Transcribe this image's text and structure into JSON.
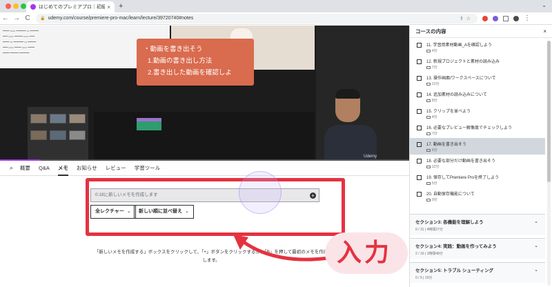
{
  "browser": {
    "tab_title": "はじめてのプレミアプロ｜初級入",
    "tab_close": "×",
    "new_tab": "+",
    "url": "udemy.com/course/premiere-pro-mac/learn/lecture/39720740#notes",
    "back": "←",
    "forward": "→",
    "reload": "C",
    "traffic_colors": [
      "#ff5f57",
      "#febc2e",
      "#28c840"
    ]
  },
  "video": {
    "overlay_lines": [
      "・動画を書き出そう",
      "1.動画の書き出し方法",
      "2.書き出した動画を確認しよ"
    ],
    "watermark": "Udemy",
    "progress_fraction": 0.1
  },
  "lecture_tabs": {
    "items": [
      "概要",
      "Q&A",
      "メモ",
      "お知らせ",
      "レビュー",
      "学習ツール"
    ],
    "active_index": 2
  },
  "notes": {
    "input_placeholder": "0:18に新しいメモを作成します",
    "add_icon_glyph": "+",
    "filter_lecture": "全レクチャー",
    "sort": "新しい順に並べ替え",
    "dropdown_chevron": "⌄",
    "help_text": "「新しいメモを作成する」ボックスをクリックして、「+」ボタンをクリックするか、「B」を押して最初のメモを作成します。"
  },
  "callout": {
    "text": "入力",
    "color": "#e53241"
  },
  "sidebar": {
    "title": "コースの内容",
    "close": "×",
    "lectures": [
      {
        "title": "11. 学習用素材動画_Aを確認しよう",
        "duration": "4分"
      },
      {
        "title": "12. 新規プロジェクトと素材の読み込み",
        "duration": "7分"
      },
      {
        "title": "13. 操作画面/ワークスペースについて",
        "duration": "12分"
      },
      {
        "title": "14. 追加素材の読み込みについて",
        "duration": "8分"
      },
      {
        "title": "15. クリップを並べよう",
        "duration": "4分"
      },
      {
        "title": "16. 必要なプレビュー解像度でチェックしよう",
        "duration": "7分"
      },
      {
        "title": "17. 動画を書き出そう",
        "duration": "6分"
      },
      {
        "title": "18. 必要な部分だけ動画を書き出そう",
        "duration": "12分"
      },
      {
        "title": "19. 保存してPremiere Proを終了しよう",
        "duration": "5分"
      },
      {
        "title": "20. 自動保存機能について",
        "duration": "9分"
      }
    ],
    "active_index": 6,
    "sections": [
      {
        "title": "セクション3: 各機能を理解しよう",
        "progress": "0 / 31 | 4時間27分"
      },
      {
        "title": "セクション4: 実践：動画を作ってみよう",
        "progress": "2 / 16 | 1時間48分"
      },
      {
        "title": "セクション5: トラブル シューティング",
        "progress": "0 / 5 | 19分"
      }
    ]
  }
}
